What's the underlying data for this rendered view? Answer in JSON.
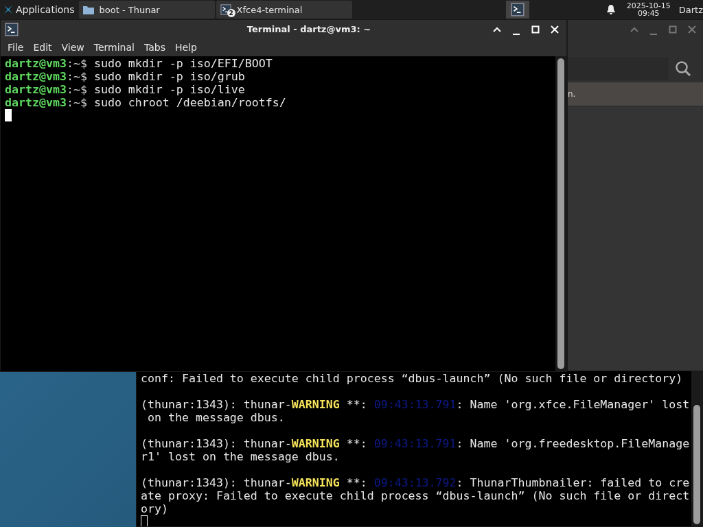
{
  "taskbar": {
    "menu_label": "Applications",
    "tasks": [
      {
        "kind": "folder",
        "title": "boot - Thunar"
      },
      {
        "kind": "terminal",
        "title": "Xfce4-terminal",
        "badge": "2"
      }
    ],
    "clock": {
      "date": "2025-10-15",
      "time": "09:45"
    },
    "user": "Dartz"
  },
  "terminal": {
    "title": "Terminal - dartz@vm3: ~",
    "menu": [
      "File",
      "Edit",
      "View",
      "Terminal",
      "Tabs",
      "Help"
    ],
    "lines": [
      {
        "prompt": "dartz@vm3",
        "path": ":~$",
        "command": "sudo mkdir -p iso/EFI/BOOT"
      },
      {
        "prompt": "dartz@vm3",
        "path": ":~$",
        "command": "sudo mkdir -p iso/grub"
      },
      {
        "prompt": "dartz@vm3",
        "path": ":~$",
        "command": "sudo mkdir -p iso/live"
      },
      {
        "prompt": "dartz@vm3",
        "path": ":~$",
        "command": "sudo chroot /deebian/rootfs/"
      }
    ]
  },
  "file_manager": {
    "status_text": "n."
  },
  "back_terminal": {
    "messages": [
      {
        "lines": [
          [
            {
              "kind": "text",
              "text": "conf: Failed to execute child process “dbus-launch” (No such file or directory)"
            }
          ]
        ]
      },
      {
        "lines": [
          [
            {
              "kind": "text",
              "text": "(thunar:1343): thunar-"
            },
            {
              "kind": "warning",
              "text": "WARNING"
            },
            {
              "kind": "text",
              "text": " **: "
            },
            {
              "kind": "timestamp",
              "text": "09:43:13.791"
            },
            {
              "kind": "text",
              "text": ": Name 'org.xfce.FileManager' lost"
            }
          ],
          [
            {
              "kind": "text",
              "text": " on the message dbus."
            }
          ]
        ]
      },
      {
        "lines": [
          [
            {
              "kind": "text",
              "text": "(thunar:1343): thunar-"
            },
            {
              "kind": "warning",
              "text": "WARNING"
            },
            {
              "kind": "text",
              "text": " **: "
            },
            {
              "kind": "timestamp",
              "text": "09:43:13.791"
            },
            {
              "kind": "text",
              "text": ": Name 'org.freedesktop.FileManage"
            }
          ],
          [
            {
              "kind": "text",
              "text": "r1' lost on the message dbus."
            }
          ]
        ]
      },
      {
        "lines": [
          [
            {
              "kind": "text",
              "text": "(thunar:1343): thunar-"
            },
            {
              "kind": "warning",
              "text": "WARNING"
            },
            {
              "kind": "text",
              "text": " **: "
            },
            {
              "kind": "timestamp",
              "text": "09:43:13.792"
            },
            {
              "kind": "text",
              "text": ": ThunarThumbnailer: failed to cre"
            }
          ],
          [
            {
              "kind": "text",
              "text": "ate proxy: Failed to execute child process “dbus-launch” (No such file or direct"
            }
          ],
          [
            {
              "kind": "text",
              "text": "ory)"
            }
          ]
        ]
      }
    ]
  }
}
